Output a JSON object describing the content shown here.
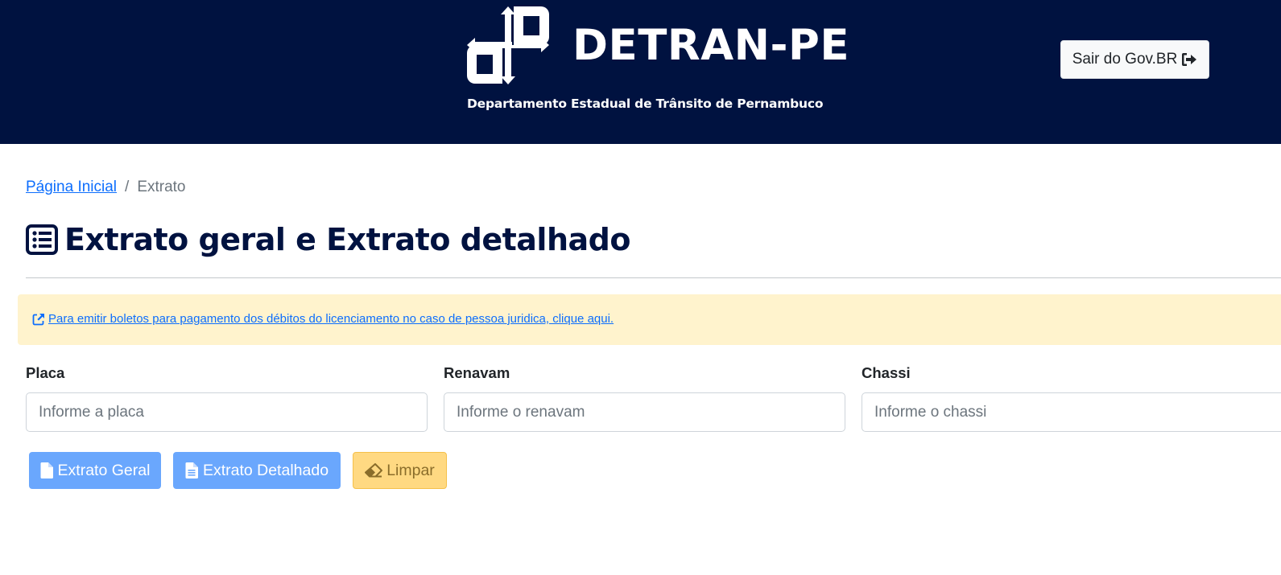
{
  "header": {
    "brand_name": "DETRAN-PE",
    "brand_subtitle": "Departamento Estadual de Trânsito de Pernambuco",
    "logout_label": "Sair do Gov.BR",
    "logo_icon": "detran-pe-logo",
    "logout_icon": "sign-out-icon",
    "background_color": "#001240"
  },
  "breadcrumb": {
    "home_label": "Página Inicial",
    "separator": "/",
    "current_label": "Extrato"
  },
  "page": {
    "title": "Extrato geral e Extrato detalhado",
    "title_icon": "list-icon"
  },
  "alert": {
    "link_text": " Para emitir boletos para pagamento dos débitos do licenciamento no caso de pessoa juridica, clique aqui.",
    "icon": "external-link-icon"
  },
  "form": {
    "placa": {
      "label": "Placa",
      "placeholder": "Informe a placa",
      "value": ""
    },
    "renavam": {
      "label": "Renavam",
      "placeholder": "Informe o renavam",
      "value": ""
    },
    "chassi": {
      "label": "Chassi",
      "placeholder": "Informe o chassi",
      "value": ""
    }
  },
  "actions": {
    "extrato_geral": "Extrato Geral",
    "extrato_detalhado": "Extrato Detalhado",
    "limpar": "Limpar"
  },
  "colors": {
    "primary_button": "#6aa7fd",
    "warning_button": "#ffd982",
    "alert_background": "#fff3cd",
    "title_color": "#001240"
  }
}
